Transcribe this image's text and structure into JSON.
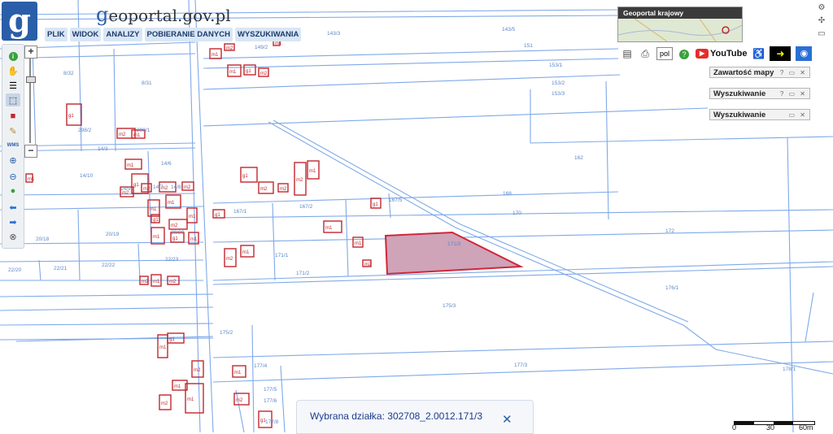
{
  "header": {
    "logo_glyph": "g",
    "brand_g": "g",
    "brand_rest": "eoportal.gov.pl",
    "menu": [
      "PLIK",
      "WIDOK",
      "ANALIZY",
      "POBIERANIE DANYCH",
      "WYSZUKIWANIA"
    ]
  },
  "toolbar": {
    "icons": [
      "info-icon",
      "hand-pan-icon",
      "layers-list-icon",
      "select-area-icon",
      "red-marker-icon",
      "pencil-icon",
      "wms-icon",
      "zoom-in-icon",
      "zoom-out-icon",
      "globe-icon",
      "back-arrow-icon",
      "forward-arrow-icon",
      "full-extent-icon"
    ],
    "wms_label": "WMS",
    "zoom_in": "+",
    "zoom_out": "−"
  },
  "minimap": {
    "title": "Geoportal krajowy"
  },
  "topbar": {
    "language": "pol",
    "youtube_label": "YouTube",
    "help_glyph": "?"
  },
  "panels": {
    "contents": "Zawartość mapy",
    "search1": "Wyszukiwanie",
    "search2": "Wyszukiwanie",
    "controls": "? ▭ ✕",
    "controls_short": "▭ ✕"
  },
  "status": {
    "label": "Wybrana działka: 302708_2.0012.171/3",
    "close": "✕"
  },
  "scale": {
    "labels": [
      "0",
      "30",
      "60m"
    ]
  },
  "map": {
    "colors": {
      "parcel_line": "#7fa9e8",
      "building": "#c0282e",
      "selected_fill": "#cfa3b8",
      "selected_stroke": "#d0263b",
      "label": "#5c86c8"
    },
    "parcel_labels": [
      "143/3",
      "143/5",
      "149/2",
      "151",
      "153/1",
      "153/2",
      "153/3",
      "8/32",
      "8/31",
      "298/2",
      "298/1",
      "14/3",
      "14/10",
      "14/6",
      "14/9",
      "14/7",
      "14/8",
      "162",
      "168",
      "167/5",
      "167/1",
      "167/2",
      "170",
      "171/3",
      "172",
      "171/1",
      "171/2",
      "20/18",
      "20/19",
      "20/20",
      "22/20",
      "22/21",
      "22/22",
      "22/23",
      "175/3",
      "176/1",
      "175/2",
      "177/3",
      "177/4",
      "177/5",
      "177/6",
      "177/8",
      "178/1"
    ],
    "building_labels": [
      "m1",
      "m2",
      "m1",
      "g1",
      "m2",
      "m1",
      "g1",
      "m2",
      "m1",
      "m1",
      "g1",
      "m2",
      "m1",
      "g1",
      "m2",
      "m1",
      "m2",
      "m1",
      "m1",
      "g1",
      "m1",
      "m2",
      "g1",
      "m2",
      "m2",
      "m2",
      "m1",
      "g1",
      "m2",
      "m1",
      "m1",
      "m1",
      "m2",
      "g1",
      "m2",
      "m1",
      "m2",
      "m1",
      "g1",
      "m2",
      "m1",
      "m2"
    ]
  }
}
